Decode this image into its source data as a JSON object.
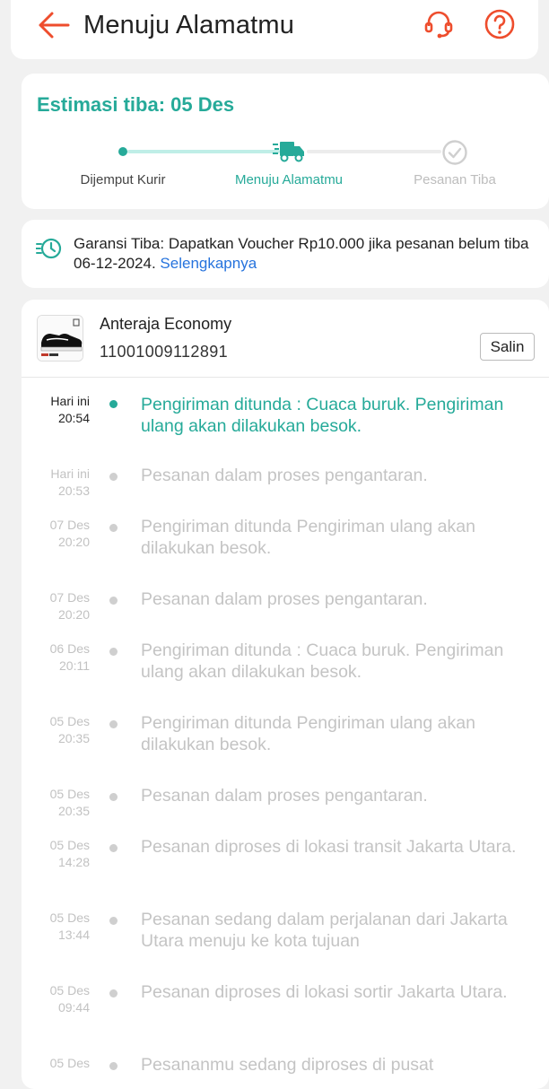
{
  "header": {
    "title": "Menuju Alamatmu",
    "back_icon": "arrow-left-icon",
    "support_icon": "headset-icon",
    "help_icon": "question-circle-icon",
    "accent_color": "#ee4d2d"
  },
  "estimate": {
    "label": "Estimasi tiba: 05 Des",
    "accent_color": "#26aa99",
    "steps": [
      {
        "label": "Dijemput Kurir",
        "status": "done"
      },
      {
        "label": "Menuju Alamatmu",
        "status": "current"
      },
      {
        "label": "Pesanan Tiba",
        "status": "pending"
      }
    ]
  },
  "guarantee": {
    "icon": "clock-fast-icon",
    "text": "Garansi Tiba: Dapatkan Voucher Rp10.000 jika pesanan belum tiba 06-12-2024.",
    "link": "Selengkapnya"
  },
  "shipment": {
    "courier": "Anteraja Economy",
    "tracking_number": "11001009112891",
    "copy_label": "Salin"
  },
  "events": [
    {
      "date": "Hari ini",
      "time": "20:54",
      "desc": "Pengiriman ditunda : Cuaca buruk. Pengiriman ulang akan dilakukan besok.",
      "active": true
    },
    {
      "date": "Hari ini",
      "time": "20:53",
      "desc": "Pesanan dalam proses pengantaran.",
      "active": false
    },
    {
      "date": "07 Des",
      "time": "20:20",
      "desc": "Pengiriman ditunda  Pengiriman ulang akan dilakukan besok.",
      "active": false
    },
    {
      "date": "07 Des",
      "time": "20:20",
      "desc": "Pesanan dalam proses pengantaran.",
      "active": false
    },
    {
      "date": "06 Des",
      "time": "20:11",
      "desc": "Pengiriman ditunda : Cuaca buruk. Pengiriman ulang akan dilakukan besok.",
      "active": false
    },
    {
      "date": "05 Des",
      "time": "20:35",
      "desc": "Pengiriman ditunda  Pengiriman ulang akan dilakukan besok.",
      "active": false
    },
    {
      "date": "05 Des",
      "time": "20:35",
      "desc": "Pesanan dalam proses pengantaran.",
      "active": false
    },
    {
      "date": "05 Des",
      "time": "14:28",
      "desc": "Pesanan diproses di lokasi transit   Jakarta Utara.",
      "active": false
    },
    {
      "date": "05 Des",
      "time": "13:44",
      "desc": "Pesanan sedang dalam perjalanan dari Jakarta Utara menuju ke kota tujuan",
      "active": false
    },
    {
      "date": "05 Des",
      "time": "09:44",
      "desc": "Pesanan diproses di lokasi sortir   Jakarta Utara.",
      "active": false
    },
    {
      "date": "05 Des",
      "time": "",
      "desc": "Pesananmu sedang diproses di pusat",
      "active": false
    }
  ]
}
